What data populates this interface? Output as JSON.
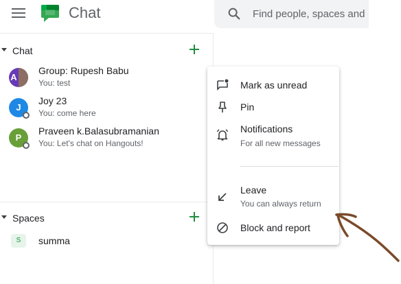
{
  "header": {
    "app_title": "Chat",
    "search_placeholder": "Find people, spaces and"
  },
  "chat_section": {
    "title": "Chat",
    "items": [
      {
        "name": "Group: Rupesh Babu",
        "preview": "You: test",
        "avatar_letter": "A",
        "avatar_color": "#673ab7"
      },
      {
        "name": "Joy 23",
        "preview": "You: come here",
        "avatar_letter": "J",
        "avatar_color": "#1e88e5"
      },
      {
        "name": "Praveen k.Balasubramanian",
        "preview": "You: Let's chat on Hangouts!",
        "avatar_letter": "P",
        "avatar_color": "#689f38"
      }
    ]
  },
  "spaces_section": {
    "title": "Spaces",
    "items": [
      {
        "name": "summa",
        "icon_letter": "S"
      }
    ]
  },
  "context_menu": {
    "mark_unread": "Mark as unread",
    "pin": "Pin",
    "notifications": "Notifications",
    "notifications_sub": "For all new messages",
    "leave": "Leave",
    "leave_sub": "You can always return",
    "block": "Block and report"
  },
  "colors": {
    "accent_green": "#1e8e3e",
    "annotation_arrow": "#7b4a2a"
  }
}
